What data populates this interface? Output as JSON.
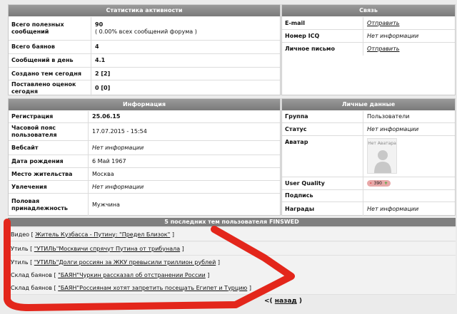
{
  "activity": {
    "title": "Статистика активности",
    "rows": [
      {
        "label": "Всего полезных сообщений",
        "value": "90",
        "sub": "( 0.00% всех сообщений форума )"
      },
      {
        "label": "Всего баянов",
        "value": "4"
      },
      {
        "label": "Сообщений в день",
        "value": "4.1"
      },
      {
        "label": "Создано тем сегодня",
        "value": "2 [2]"
      },
      {
        "label": "Поставлено оценок сегодня",
        "value": "0 [0]"
      }
    ]
  },
  "contact": {
    "title": "Связь",
    "rows": [
      {
        "label": "E-mail",
        "value": "Отправить"
      },
      {
        "label": "Номер ICQ",
        "value": "Нет информации"
      },
      {
        "label": "Личное письмо",
        "value": "Отправить"
      }
    ]
  },
  "info": {
    "title": "Информация",
    "rows": [
      {
        "label": "Регистрация",
        "value": "25.06.15"
      },
      {
        "label": "Часовой пояс пользователя",
        "value": "17.07.2015 - 15:54"
      },
      {
        "label": "Вебсайт",
        "value": "Нет информации"
      },
      {
        "label": "Дата рождения",
        "value": "6 Май 1967"
      },
      {
        "label": "Место жительства",
        "value": "Москва"
      },
      {
        "label": "Увлечения",
        "value": "Нет информации"
      },
      {
        "label": "Половая принадлежность",
        "value": "Мужчина"
      }
    ]
  },
  "personal": {
    "title": "Личные данные",
    "rows": [
      {
        "label": "Группа",
        "value": "Пользователи"
      },
      {
        "label": "Статус",
        "value": "Нет информации"
      },
      {
        "label": "Аватар",
        "avatar_text": "Нет Аватара"
      },
      {
        "label": "User Quality",
        "quality": "390",
        "minus": "-",
        "plus": "+"
      },
      {
        "label": "Подпись",
        "value": ""
      },
      {
        "label": "Награды",
        "value": "Нет информации"
      }
    ]
  },
  "topics": {
    "title": "5 последних тем пользователя FINSWED",
    "items": [
      {
        "section": "Видео",
        "open": "[",
        "link": "Житель Кузбасса - Путину: \"Предел Близок\"",
        "close": "]"
      },
      {
        "section": "Утиль",
        "open": "[",
        "link": "\"УТИЛЬ\"Москвичи спрячут Путина от трибунала",
        "close": "]"
      },
      {
        "section": "Утиль",
        "open": "[",
        "link": "\"УТИЛЬ\"Долги россиян за ЖКУ превысили триллион рублей",
        "close": "]"
      },
      {
        "section": "Склад баянов",
        "open": "[",
        "link": "\"БАЯН\"Чуркин рассказал об отстранении России",
        "close": "]"
      },
      {
        "section": "Склад баянов",
        "open": "[",
        "link": "\"БАЯН\"Россиянам хотят запретить посещать Египет и Турцию",
        "close": "]"
      }
    ]
  },
  "back": {
    "prefix": "<(",
    "label": "назад",
    "suffix": ")"
  }
}
